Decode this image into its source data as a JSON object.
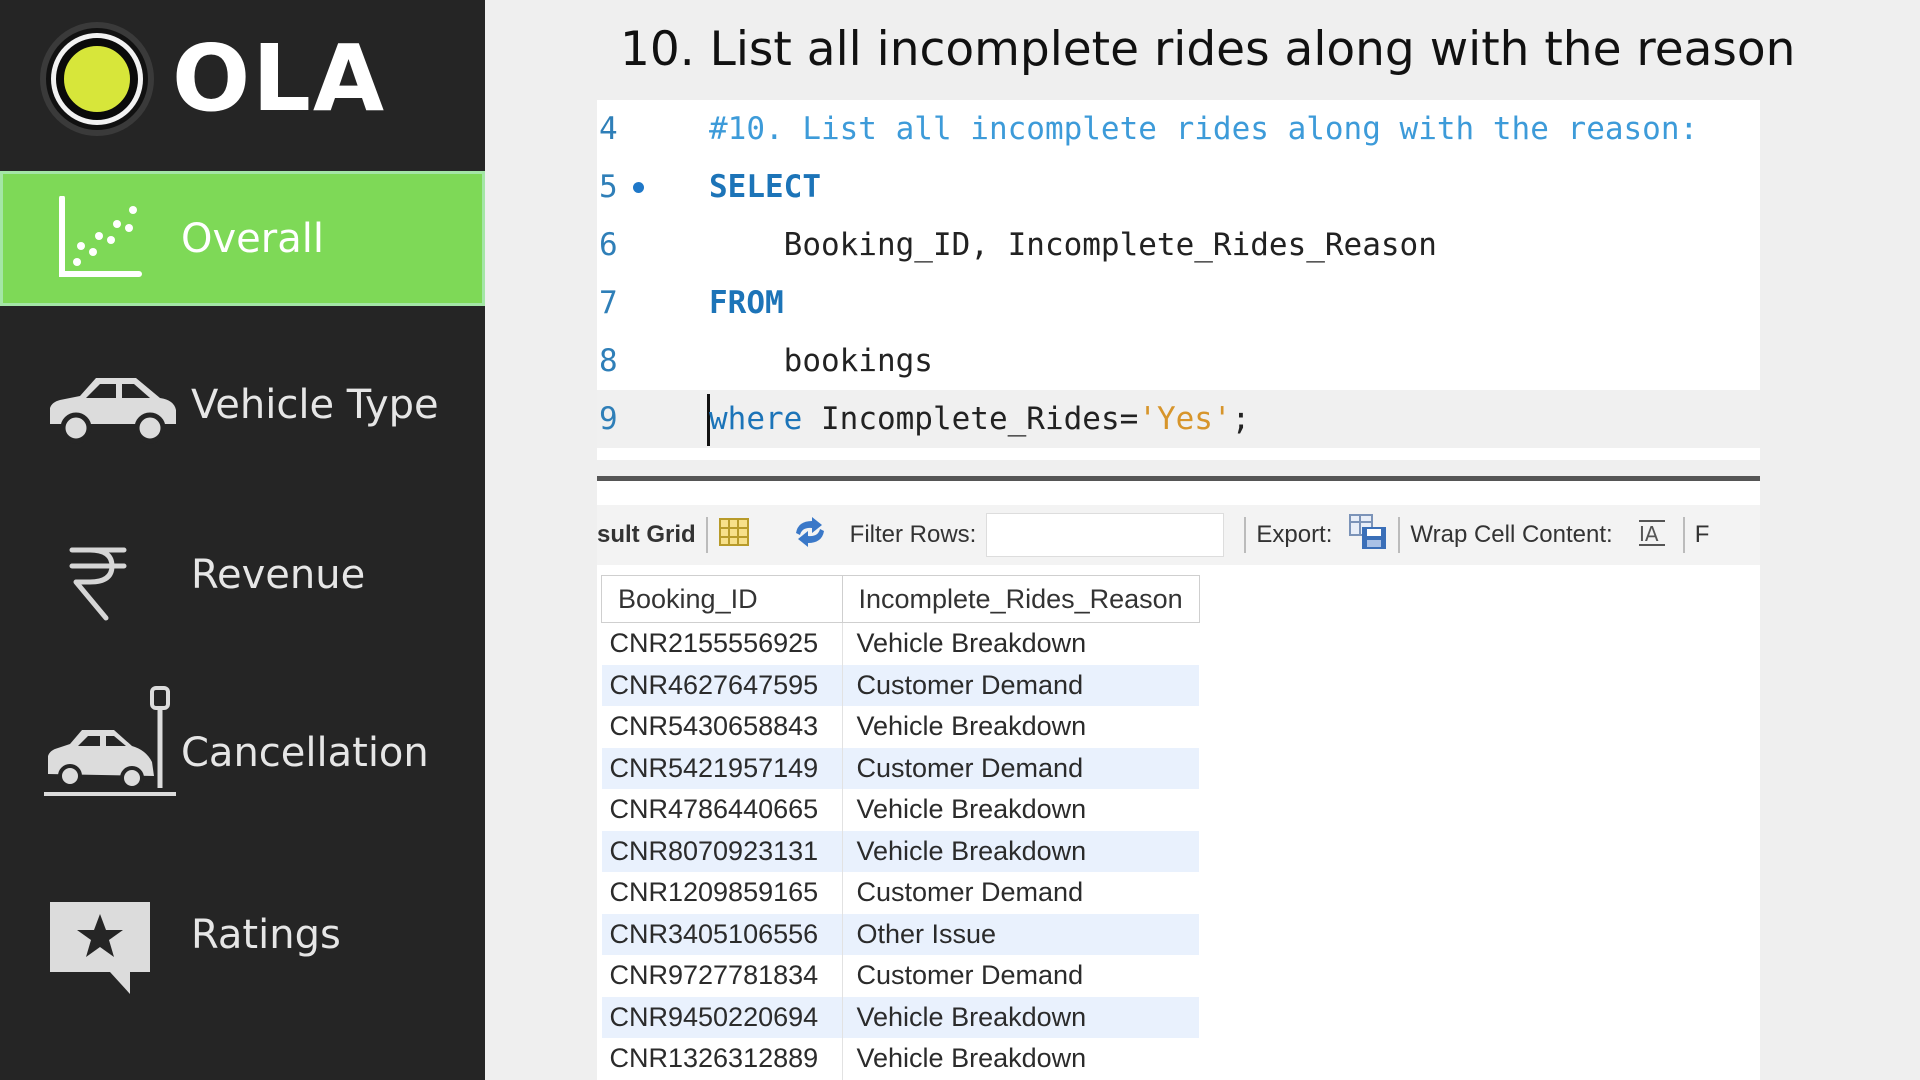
{
  "sidebar": {
    "logo_text": "OLA",
    "items": [
      {
        "label": "Overall",
        "icon": "scatter-chart-icon",
        "active": true
      },
      {
        "label": "Vehicle Type",
        "icon": "car-icon",
        "active": false
      },
      {
        "label": "Revenue",
        "icon": "rupee-icon",
        "active": false
      },
      {
        "label": "Cancellation",
        "icon": "car-crash-icon",
        "active": false
      },
      {
        "label": "Ratings",
        "icon": "star-speech-bubble-icon",
        "active": false
      }
    ]
  },
  "title": "10. List all incomplete rides along with the reason",
  "editor": {
    "lines": [
      {
        "num": "4",
        "comment": "#10. List all incomplete rides along with the reason:"
      },
      {
        "num": "5",
        "keyword": "SELECT"
      },
      {
        "num": "6",
        "text": "    Booking_ID, Incomplete_Rides_Reason"
      },
      {
        "num": "7",
        "keyword": "FROM"
      },
      {
        "num": "8",
        "text": "    bookings"
      },
      {
        "num": "9",
        "keyword": "where",
        "text": " Incomplete_Rides=",
        "string": "'Yes'",
        "end": ";"
      }
    ]
  },
  "toolbar": {
    "result_grid_label": "sult Grid",
    "filter_label": "Filter Rows:",
    "filter_value": "",
    "export_label": "Export:",
    "wrap_label": "Wrap Cell Content:",
    "trailing": "F"
  },
  "results": {
    "columns": [
      "Booking_ID",
      "Incomplete_Rides_Reason"
    ],
    "rows": [
      [
        "CNR2155556925",
        "Vehicle Breakdown"
      ],
      [
        "CNR4627647595",
        "Customer Demand"
      ],
      [
        "CNR5430658843",
        "Vehicle Breakdown"
      ],
      [
        "CNR5421957149",
        "Customer Demand"
      ],
      [
        "CNR4786440665",
        "Vehicle Breakdown"
      ],
      [
        "CNR8070923131",
        "Vehicle Breakdown"
      ],
      [
        "CNR1209859165",
        "Customer Demand"
      ],
      [
        "CNR3405106556",
        "Other Issue"
      ],
      [
        "CNR9727781834",
        "Customer Demand"
      ],
      [
        "CNR9450220694",
        "Vehicle Breakdown"
      ],
      [
        "CNR1326312889",
        "Vehicle Breakdown"
      ]
    ]
  },
  "colors": {
    "sidebar_bg": "#252525",
    "active_bg": "#7ed957",
    "logo_yellow": "#d7e63a",
    "sql_keyword": "#1c74b8",
    "sql_string": "#d7952b",
    "row_alt": "#e9f1fd"
  }
}
